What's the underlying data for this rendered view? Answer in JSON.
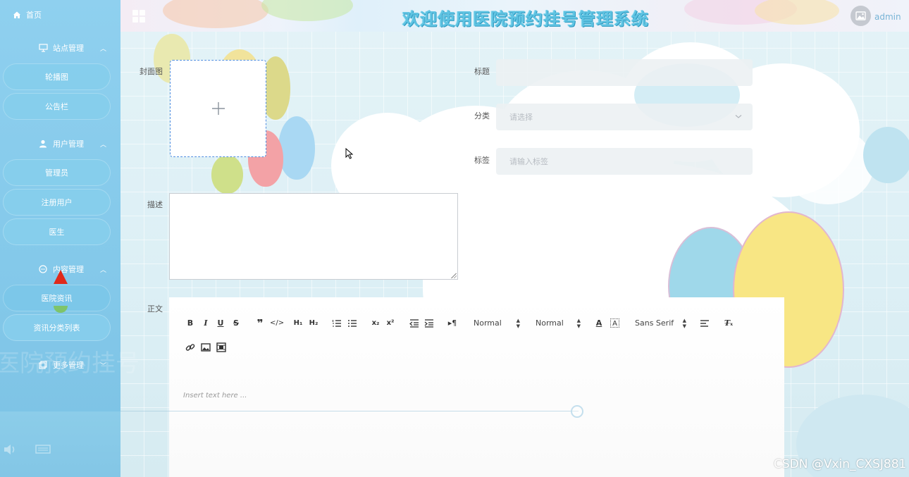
{
  "header": {
    "title": "欢迎使用医院预约挂号管理系统",
    "username": "admin"
  },
  "sidebar": {
    "home": "首页",
    "groups": [
      {
        "label": "站点管理",
        "icon": "monitor-icon",
        "items": [
          "轮播图",
          "公告栏"
        ]
      },
      {
        "label": "用户管理",
        "icon": "user-icon",
        "items": [
          "管理员",
          "注册用户",
          "医生"
        ]
      },
      {
        "label": "内容管理",
        "icon": "chat-icon",
        "items": [
          "医院资讯",
          "资讯分类列表"
        ]
      },
      {
        "label": "更多管理",
        "icon": "copy-icon",
        "items": []
      }
    ]
  },
  "form": {
    "cover_label": "封面图",
    "title_label": "标题",
    "title_value": "",
    "category_label": "分类",
    "category_placeholder": "请选择",
    "tag_label": "标签",
    "tag_placeholder": "请输入标签",
    "desc_label": "描述",
    "body_label": "正文"
  },
  "editor": {
    "header_select": "Normal",
    "size_select": "Normal",
    "font_select": "Sans Serif",
    "placeholder": "Insert text here ..."
  },
  "watermark": "CSDN @Vxin_CXSJ881",
  "colors": {
    "sidebar": "#84c9ea",
    "title_text": "#5fc3e2",
    "cover_border": "#4f8ee0"
  }
}
